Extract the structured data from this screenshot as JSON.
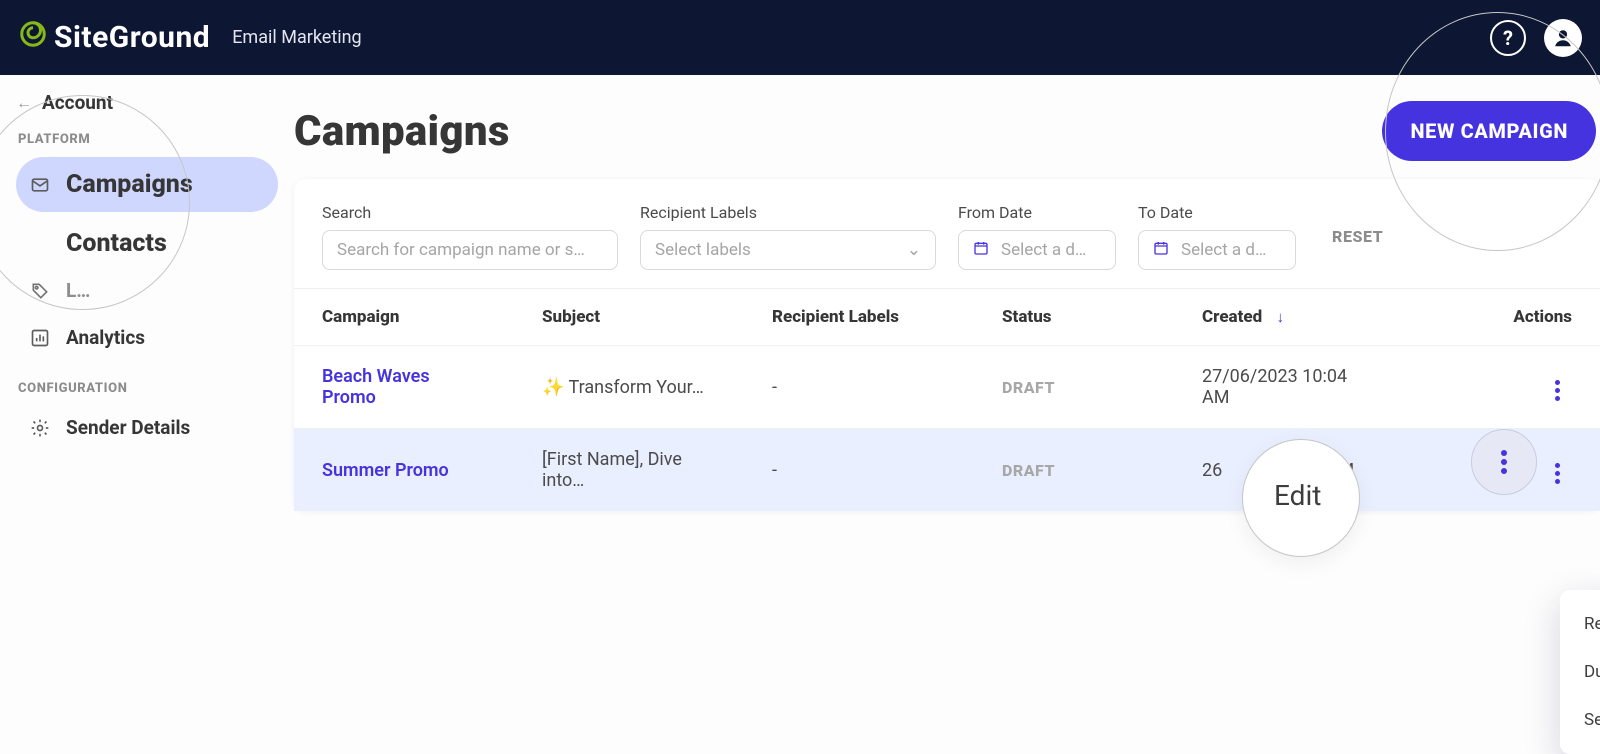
{
  "header": {
    "logo_text": "SiteGround",
    "subtitle": "Email Marketing"
  },
  "sidebar": {
    "back_label": "Account",
    "section_platform": "PLATFORM",
    "section_config": "CONFIGURATION",
    "items": {
      "campaigns": "Campaigns",
      "contacts": "Contacts",
      "analytics": "Analytics",
      "sender_details": "Sender Details"
    }
  },
  "page": {
    "title": "Campaigns",
    "new_campaign": "NEW CAMPAIGN"
  },
  "filters": {
    "search_label": "Search",
    "search_placeholder": "Search for campaign name or s…",
    "labels_label": "Recipient Labels",
    "labels_placeholder": "Select labels",
    "from_label": "From Date",
    "to_label": "To Date",
    "date_placeholder": "Select a d…",
    "reset": "RESET"
  },
  "table": {
    "headers": {
      "campaign": "Campaign",
      "subject": "Subject",
      "labels": "Recipient Labels",
      "status": "Status",
      "created": "Created",
      "actions": "Actions"
    },
    "rows": [
      {
        "campaign": "Beach Waves Promo",
        "subject": "✨ Transform Your…",
        "labels": "-",
        "status": "DRAFT",
        "created": "27/06/2023 10:04 AM"
      },
      {
        "campaign": "Summer Promo",
        "subject": "[First Name], Dive into…",
        "labels": "-",
        "status": "DRAFT",
        "created": "26                 :02 PM"
      }
    ]
  },
  "menu": {
    "edit": "Edit",
    "rename": "Rename",
    "duplicate": "Duplicate",
    "send": "Send"
  }
}
